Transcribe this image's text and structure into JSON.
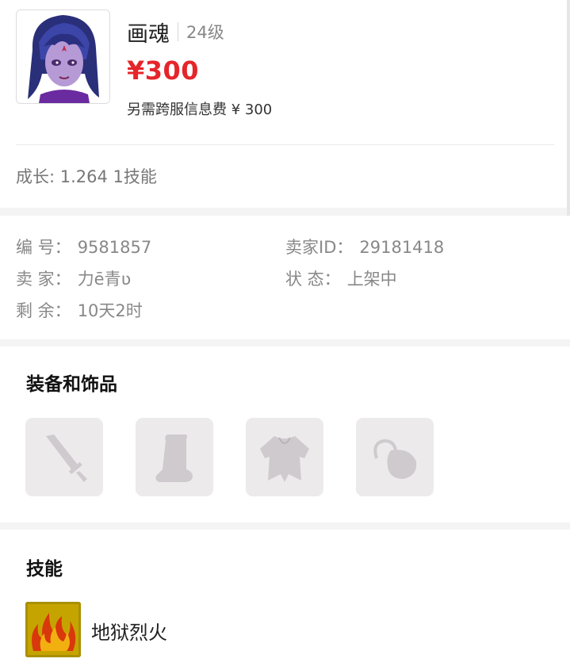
{
  "header": {
    "pet_name": "画魂",
    "level": "24级",
    "price": "¥300",
    "fee_text": "另需跨服信息费 ¥ 300",
    "growth_text": "成长: 1.264 1技能",
    "avatar_icon": "demon-girl-avatar-icon"
  },
  "info": {
    "number_label": "编 号：",
    "number_value": "9581857",
    "seller_id_label": "卖家ID：",
    "seller_id_value": "29181418",
    "seller_label": "卖 家：",
    "seller_value": "力ē青ʋ",
    "status_label": "状 态：",
    "status_value": "上架中",
    "remaining_label": "剩 余：",
    "remaining_value": "10天2时"
  },
  "equipment": {
    "title": "装备和饰品",
    "slots": [
      {
        "icon": "weapon-sword-icon"
      },
      {
        "icon": "boots-icon"
      },
      {
        "icon": "armor-icon"
      },
      {
        "icon": "accessory-pouch-icon"
      }
    ]
  },
  "skills": {
    "title": "技能",
    "items": [
      {
        "name": "地狱烈火",
        "icon": "hellfire-skill-icon"
      }
    ]
  },
  "colors": {
    "price": "#e5252a",
    "label": "#888888",
    "slot_bg": "#edeaec",
    "slot_icon": "#cfcacd",
    "skill_bg": "#a89000"
  }
}
